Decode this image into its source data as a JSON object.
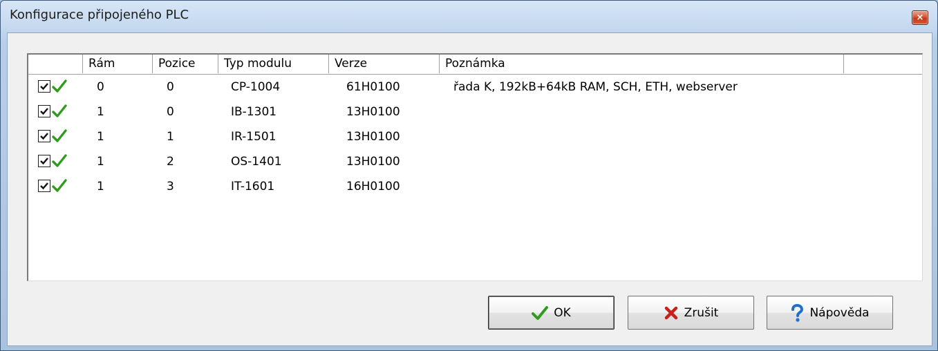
{
  "window": {
    "title": "Konfigurace připojeného PLC",
    "close_symbol": "×"
  },
  "list": {
    "columns": [
      "",
      "Rám",
      "Pozice",
      "Typ modulu",
      "Verze",
      "Poznámka",
      ""
    ],
    "rows": [
      {
        "checked": true,
        "status": "ok",
        "ram": "0",
        "pozice": "0",
        "typ": "CP-1004",
        "verze": "61H0100",
        "poznamka": "řada K, 192kB+64kB RAM, SCH, ETH, webserver"
      },
      {
        "checked": true,
        "status": "ok",
        "ram": "1",
        "pozice": "0",
        "typ": "IB-1301",
        "verze": "13H0100",
        "poznamka": ""
      },
      {
        "checked": true,
        "status": "ok",
        "ram": "1",
        "pozice": "1",
        "typ": "IR-1501",
        "verze": "13H0100",
        "poznamka": ""
      },
      {
        "checked": true,
        "status": "ok",
        "ram": "1",
        "pozice": "2",
        "typ": "OS-1401",
        "verze": "13H0100",
        "poznamka": ""
      },
      {
        "checked": true,
        "status": "ok",
        "ram": "1",
        "pozice": "3",
        "typ": "IT-1601",
        "verze": "16H0100",
        "poznamka": ""
      }
    ]
  },
  "buttons": {
    "ok": {
      "label": "OK",
      "icon": "checkmark-icon"
    },
    "cancel": {
      "label": "Zrušit",
      "icon": "x-icon"
    },
    "help": {
      "label": "Nápověda",
      "icon": "question-icon"
    }
  },
  "colors": {
    "check_green": "#2e9b1c",
    "cancel_red": "#c8201b",
    "help_blue": "#1e6fd0"
  }
}
